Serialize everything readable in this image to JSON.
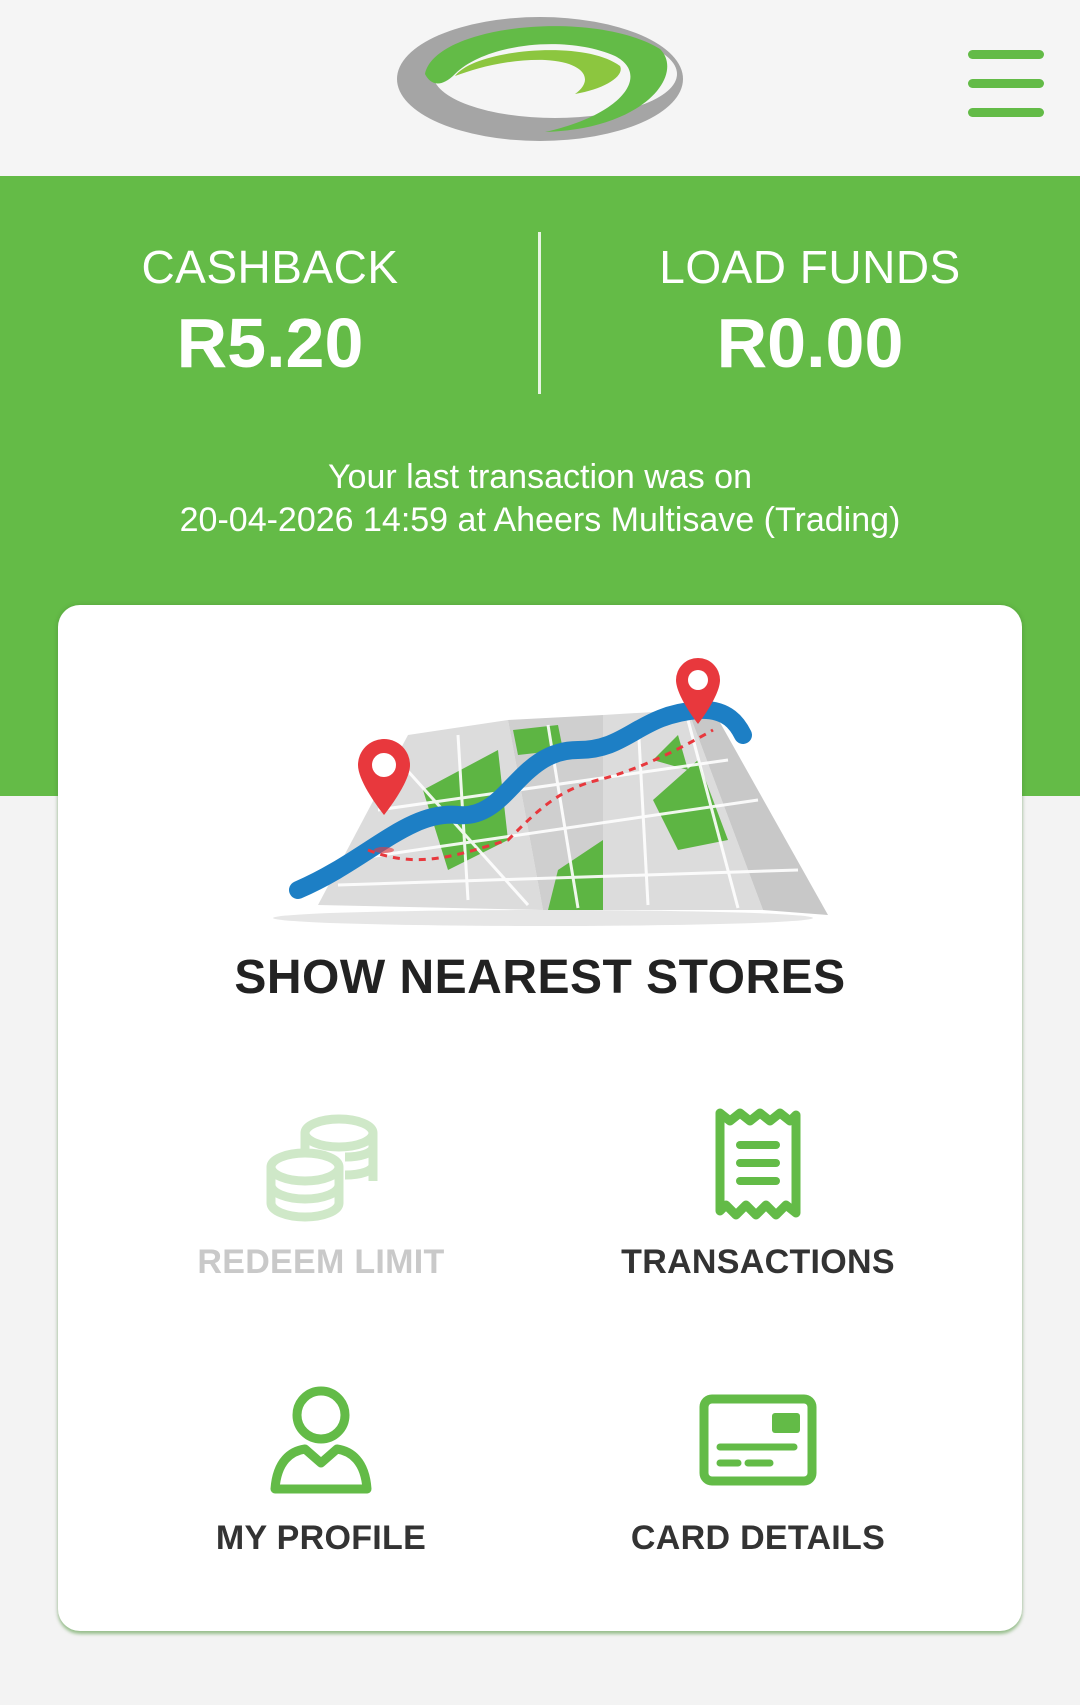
{
  "header": {
    "logo_icon": "brand-swirl-logo",
    "menu_icon": "hamburger-menu-icon"
  },
  "balances": {
    "cashback_label": "CASHBACK",
    "cashback_value": "R5.20",
    "load_funds_label": "LOAD FUNDS",
    "load_funds_value": "R0.00"
  },
  "last_transaction": {
    "line1": "Your last transaction was on",
    "line2": "20-04-2026 14:59 at Aheers Multisave (Trading)"
  },
  "stores": {
    "title": "SHOW NEAREST STORES",
    "icon": "map-with-pins-icon"
  },
  "tiles": [
    {
      "label": "REDEEM LIMIT",
      "icon": "coins-icon",
      "enabled": false
    },
    {
      "label": "TRANSACTIONS",
      "icon": "receipt-icon",
      "enabled": true
    },
    {
      "label": "MY PROFILE",
      "icon": "user-icon",
      "enabled": true
    },
    {
      "label": "CARD DETAILS",
      "icon": "credit-card-icon",
      "enabled": true
    }
  ],
  "colors": {
    "brand_green": "#64bb47",
    "disabled_green": "#cfe8c8",
    "map_blue": "#1d7fc5",
    "pin_red": "#e8383d"
  }
}
